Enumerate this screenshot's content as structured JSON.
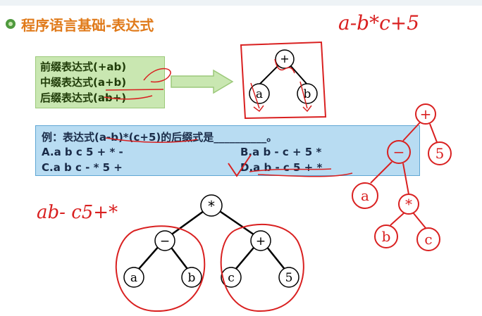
{
  "title": "程序语言基础-表达式",
  "notation_box": {
    "prefix": "前缀表达式(+ab)",
    "infix": "中缀表达式(a+b)",
    "postfix": "后缀表达式(ab+)"
  },
  "small_tree": {
    "root": "+",
    "left": "a",
    "right": "b"
  },
  "question": {
    "prompt": "例：表达式(a-b)*(c+5)的后缀式是__________。",
    "option_a": "A.a b c 5 + * -",
    "option_b": "B.a b - c + 5 *",
    "option_c": "C.a b c - * 5 +",
    "option_d": "D.a b - c 5 + *"
  },
  "expression_tree": {
    "root": "*",
    "left_op": "−",
    "right_op": "+",
    "leaves": [
      "a",
      "b",
      "c",
      "5"
    ]
  },
  "handwriting": {
    "top_right": "a-b*c+5",
    "bottom_left": "ab- c5+*",
    "right_tree_nodes": [
      "+",
      "−",
      "5",
      "a",
      "*",
      "b",
      "c"
    ]
  },
  "colors": {
    "title": "#e07a1a",
    "ink": "#d92020",
    "green_box": "#c9e7b1",
    "blue_box": "#b8dcf2"
  }
}
